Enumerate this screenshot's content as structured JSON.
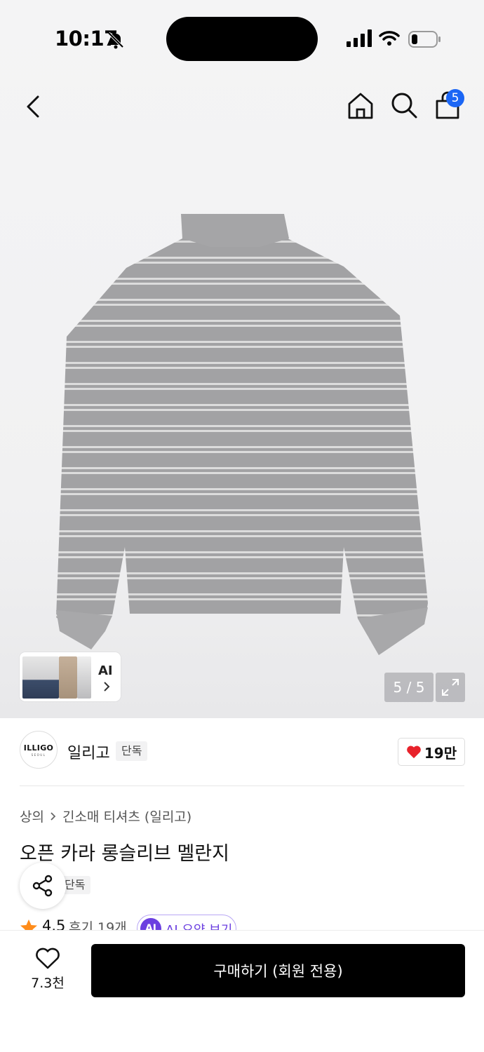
{
  "status_bar": {
    "time": "10:17"
  },
  "header": {
    "cart_count": "5"
  },
  "gallery": {
    "ai_label": "AI",
    "counter": "5 / 5"
  },
  "brand": {
    "logo_line1": "ILLIGO",
    "logo_line2": "SEOUL",
    "name": "일리고",
    "exclusive": "단독",
    "likes": "19만"
  },
  "breadcrumb": {
    "category": "상의",
    "subcategory": "긴소매 티셔츠 (일리고)"
  },
  "product": {
    "title": "오픈 카라 롱슬리브 멜란지",
    "exclusive": "단독"
  },
  "rating": {
    "score": "4.5",
    "reviews": "후기 19개",
    "ai_badge": "AI",
    "ai_summary": "AI 요약 보기"
  },
  "bottom": {
    "wish_count": "7.3천",
    "buy_label": "구매하기 (회원 전용)"
  },
  "colors": {
    "accent_blue": "#1b66f5",
    "ai_purple": "#6b3fe0",
    "heart_red": "#e8222b",
    "star_orange": "#ff8c1a"
  }
}
